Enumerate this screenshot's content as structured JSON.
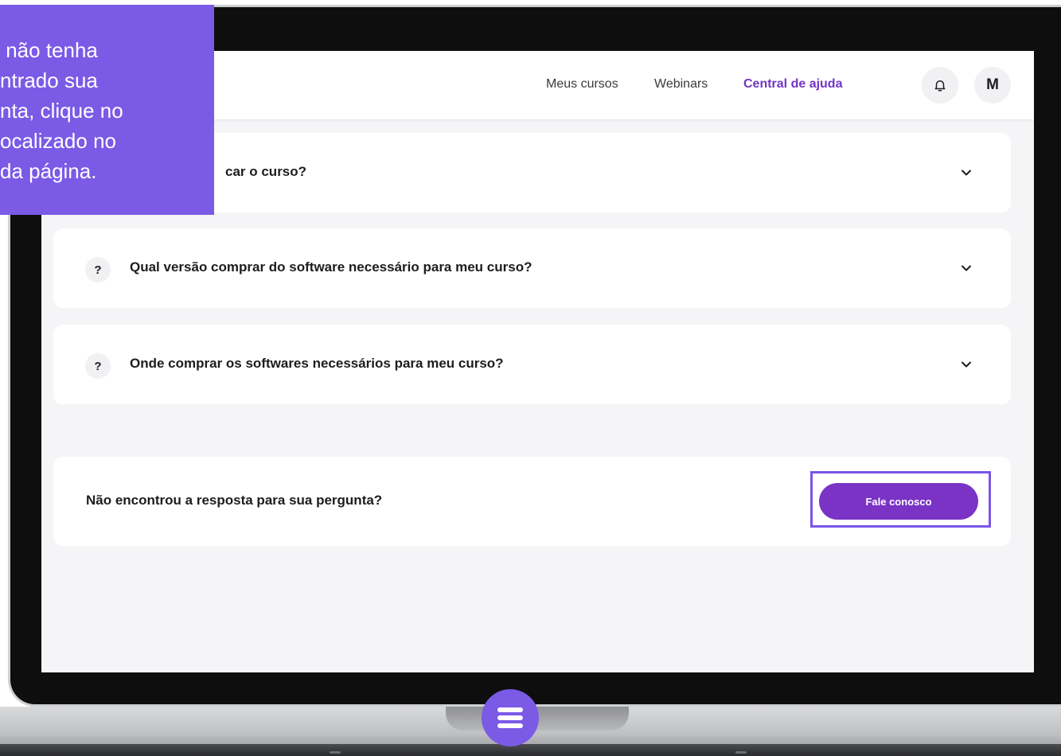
{
  "header": {
    "nav": [
      "Meus cursos",
      "Webinars",
      "Central de ajuda"
    ],
    "active_nav": "Central de ajuda",
    "avatar_initial": "M",
    "accent_color": "#7236c4"
  },
  "faq": [
    {
      "question_visible": "car o curso?"
    },
    {
      "question": "Qual versão comprar do software necessário para meu curso?"
    },
    {
      "question": "Onde comprar os softwares necessários para meu curso?"
    }
  ],
  "faq_badge": "?",
  "contact": {
    "prompt": "Não encontrou a resposta para sua pergunta?",
    "button_label": "Fale conosco",
    "button_color": "#7a33c5"
  },
  "tooltip": {
    "text": " não tenha\nntrado sua\nnta, clique no\nocalizado no\nda página.",
    "color": "#7b5ae6"
  },
  "icons": {
    "bell": "bell-icon",
    "chevron": "chevron-down-icon",
    "menu": "menu-icon"
  }
}
